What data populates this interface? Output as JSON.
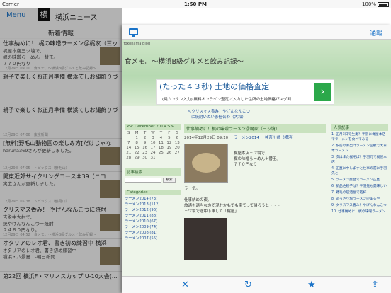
{
  "status_bar": {
    "carrier": "Carrier",
    "time": "1:50 PM",
    "battery": "100%",
    "wifi_icon": "wifi-icon"
  },
  "left_nav": {
    "menu_label": "Menu",
    "logo_glyph": "横",
    "app_title": "横浜ニュース",
    "list_title": "新着情報"
  },
  "feed": [
    {
      "title": "仕事納めに！ 梶の味噌ラーメン＠梶家（三ッ",
      "desc": "梶屋本店三ツ境で、\n梶の味噌らーめん＋替玉。\n７７０円なり",
      "meta": "12月29日 09:10　食メモ。〜横浜B級グルメと飲み記録〜",
      "thumb": true
    },
    {
      "title": "親子で楽しくお正月準備 横浜てしお縄飾りづくり",
      "desc": "",
      "meta": "",
      "thumb": false
    },
    {
      "title": "親子で楽しくお正月準備 横浜てしお縄飾りづくり - 東京新",
      "desc": "",
      "meta": "12月29日 07:06　東京新聞",
      "thumb": false
    },
    {
      "title": "[無料]野毛山動物園の楽しみ方[だけじゃな",
      "desc": "haruna369さんが更新しました。",
      "meta": "12月29日 07:05　トピックス（野毛山）",
      "thumb": true
    },
    {
      "title": "関東近郊サイクリングコース＃39（ニコ",
      "desc": "実広さんが更新しました。",
      "meta": "12月29日 05:38　トピックス（鶴見川）",
      "thumb": true
    },
    {
      "title": "クリスマス香み！ やげんなんこつに焼酎",
      "desc": "吉永中大村で、\n焼やげんなんこつ＋焼酎\n２４６０円なり。",
      "meta": "12月29日 04:52　食メモ。〜横浜B級グルメと飲み記録〜",
      "thumb": true
    },
    {
      "title": "オタリアのレオ君、書き初め練習中 横浜",
      "desc": "オタリアのレオ君、書き初め練習中\n横浜・八景島　-朝日新聞",
      "meta": "",
      "thumb": true
    },
    {
      "title": "第22回 横浜F・マリノスカップ U-10大会(...",
      "desc": "",
      "meta": "",
      "thumb": false
    }
  ],
  "browser": {
    "notify_label": "通報",
    "tab_icon": "monitor-icon",
    "blog_brand": "Yokohama Blog",
    "blog_title": "食メモ。〜横浜B級グルメと飲み記録〜",
    "ad_headline": "(たった４３秒) 土地の価格査定",
    "ad_sub": "(縄カンタン入力) 無料オンライン査定／入力した住所の土地価格がスグ判",
    "ad_arrow": "›",
    "prev_link": "＜クリスマス香み！やげんなんこつ",
    "next_link": "に焼酎いぬいま仕合わ（大和）",
    "calendar": {
      "prev": "<<",
      "month": "December 2014",
      "next": ">>",
      "dow": [
        "S",
        "M",
        "T",
        "W",
        "T",
        "F",
        "S"
      ],
      "days": [
        "",
        "1",
        "2",
        "3",
        "4",
        "5",
        "6",
        "7",
        "8",
        "9",
        "10",
        "11",
        "12",
        "13",
        "14",
        "15",
        "16",
        "17",
        "18",
        "19",
        "20",
        "21",
        "22",
        "23",
        "24",
        "25",
        "26",
        "27",
        "28",
        "29",
        "30",
        "31",
        "",
        "",
        ""
      ]
    },
    "search_title": "記事検索",
    "search_button": "検索",
    "categories_title": "Categories",
    "categories": [
      "ラーメン2014 (73)",
      "ラーメン2013 (112)",
      "ラーメン2012 (96)",
      "ラーメン2011 (88)",
      "ラーメン2010 (67)",
      "ラーメン2009 (74)",
      "ラーメン2008 (81)",
      "ラーメン2007 (55)"
    ],
    "post_title": "仕事納めに！梶の味噌ラーメン＠梶家（三ッ境）",
    "post_date": "2014年12月29日 09:10",
    "post_category": "ラーメン2014",
    "post_tags": "神奈川県（横浜）",
    "post_caption": "梶屋本店三ツ境で、\n梶の味噌らーめん＋替玉。\n７７０円なり",
    "post_text": "ラー気。\n\n仕事納めの夜。\n旅通も適当なので混むかもでも来てって帰ろうと・・・\n三ツ境で途中下車して「梶屋」",
    "ranking_title": "人気記事",
    "ranking": [
      "1. 正月3日で生麦？手羽に梶屋本店でラーメンを食べてみる",
      "2. 駅前のお出汁ラーメン堂散で大日本ラーメン",
      "3. 次はまた梶そば！手羽元で梶屋本店",
      "4. 正直に中しますと仕事の前に手羽先と",
      "5. ラーメン屋台でラーメン正直",
      "6. 新品色餃子は？手羽先も美味しい",
      "7. 野毛の居酒屋で乾杯",
      "8. あっさり塩ラーメン＠まるや",
      "9. クリスマス香み！やげんなんこつ",
      "10. 仕事納めに！梶の味噌ラーメン"
    ],
    "toolbar": {
      "close": "✕",
      "reload": "↻",
      "favorite": "★",
      "share": "⇪"
    }
  }
}
